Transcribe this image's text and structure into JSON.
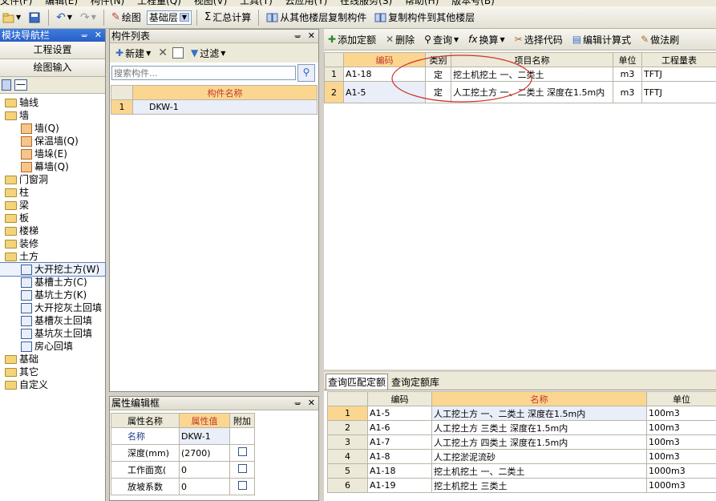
{
  "menubar": [
    "文件(F)",
    "编辑(E)",
    "构件(N)",
    "工程量(Q)",
    "视图(V)",
    "工具(T)",
    "云应用(Y)",
    "在线服务(S)",
    "帮助(H)",
    "版本号(B)"
  ],
  "toolbar": {
    "draw_label": "绘图",
    "floor_value": "基础层",
    "sum_label": "汇总计算",
    "copy_from_label": "从其他楼层复制构件",
    "copy_to_label": "复制构件到其他楼层"
  },
  "nav": {
    "title": "模块导航栏",
    "btn_settings": "工程设置",
    "btn_draw": "绘图输入",
    "tree": [
      {
        "label": "轴线",
        "type": "folder",
        "indent": 0
      },
      {
        "label": "墙",
        "type": "folder",
        "indent": 0
      },
      {
        "label": "墙(Q)",
        "type": "leaf",
        "indent": 1
      },
      {
        "label": "保温墙(Q)",
        "type": "leaf",
        "indent": 1
      },
      {
        "label": "墙垛(E)",
        "type": "leaf",
        "indent": 1
      },
      {
        "label": "幕墙(Q)",
        "type": "leaf",
        "indent": 1
      },
      {
        "label": "门窗洞",
        "type": "folder",
        "indent": 0
      },
      {
        "label": "柱",
        "type": "folder",
        "indent": 0
      },
      {
        "label": "梁",
        "type": "folder",
        "indent": 0
      },
      {
        "label": "板",
        "type": "folder",
        "indent": 0
      },
      {
        "label": "楼梯",
        "type": "folder",
        "indent": 0
      },
      {
        "label": "装修",
        "type": "folder",
        "indent": 0
      },
      {
        "label": "土方",
        "type": "folder",
        "indent": 0
      },
      {
        "label": "大开挖土方(W)",
        "type": "leaf",
        "indent": 1
      },
      {
        "label": "基槽土方(C)",
        "type": "leaf",
        "indent": 1
      },
      {
        "label": "基坑土方(K)",
        "type": "leaf",
        "indent": 1
      },
      {
        "label": "大开挖灰土回填",
        "type": "leaf",
        "indent": 1
      },
      {
        "label": "基槽灰土回填",
        "type": "leaf",
        "indent": 1
      },
      {
        "label": "基坑灰土回填",
        "type": "leaf",
        "indent": 1
      },
      {
        "label": "房心回填",
        "type": "leaf",
        "indent": 1
      },
      {
        "label": "基础",
        "type": "folder",
        "indent": 0
      },
      {
        "label": "其它",
        "type": "folder",
        "indent": 0
      },
      {
        "label": "自定义",
        "type": "folder",
        "indent": 0
      }
    ]
  },
  "component_list": {
    "title": "构件列表",
    "new_label": "新建",
    "filter_label": "过滤",
    "search_placeholder": "搜索构件...",
    "col_name": "构件名称",
    "rows": [
      {
        "idx": "1",
        "name": "DKW-1"
      }
    ]
  },
  "props": {
    "title": "属性编辑框",
    "col_name": "属性名称",
    "col_value": "属性值",
    "col_extra": "附加",
    "rows": [
      {
        "name": "名称",
        "value": "DKW-1",
        "checkbox": false
      },
      {
        "name": "深度(mm)",
        "value": "(2700)",
        "checkbox": true
      },
      {
        "name": "工作面宽(",
        "value": "0",
        "checkbox": true
      },
      {
        "name": "放坡系数",
        "value": "0",
        "checkbox": true
      }
    ]
  },
  "quota_toolbar": {
    "add_label": "添加定额",
    "delete_label": "删除",
    "query_label": "查询",
    "convert_label": "换算",
    "select_code_label": "选择代码",
    "edit_formula_label": "编辑计算式",
    "method_label": "做法刷"
  },
  "quota_table": {
    "headers": {
      "code": "编码",
      "type": "类别",
      "name": "项目名称",
      "unit": "单位",
      "expr": "工程量表"
    },
    "rows": [
      {
        "idx": "1",
        "code": "A1-18",
        "type": "定",
        "name": "挖土机挖土 一、二类土",
        "unit": "m3",
        "expr": "TFTJ"
      },
      {
        "idx": "2",
        "code": "A1-5",
        "type": "定",
        "name": "人工挖土方 一、二类土 深度在1.5m内",
        "unit": "m3",
        "expr": "TFTJ"
      }
    ]
  },
  "query": {
    "tab_match": "查询匹配定额",
    "tab_lib": "查询定额库",
    "headers": {
      "code": "编码",
      "name": "名称",
      "unit": "单位"
    },
    "rows": [
      {
        "idx": "1",
        "code": "A1-5",
        "name": "人工挖土方 一、二类土 深度在1.5m内",
        "unit": "100m3"
      },
      {
        "idx": "2",
        "code": "A1-6",
        "name": "人工挖土方 三类土 深度在1.5m内",
        "unit": "100m3"
      },
      {
        "idx": "3",
        "code": "A1-7",
        "name": "人工挖土方 四类土 深度在1.5m内",
        "unit": "100m3"
      },
      {
        "idx": "4",
        "code": "A1-8",
        "name": "人工挖淤泥流砂",
        "unit": "100m3"
      },
      {
        "idx": "5",
        "code": "A1-18",
        "name": "挖土机挖土 一、二类土",
        "unit": "1000m3"
      },
      {
        "idx": "6",
        "code": "A1-19",
        "name": "挖土机挖土 三类土",
        "unit": "1000m3"
      }
    ]
  }
}
